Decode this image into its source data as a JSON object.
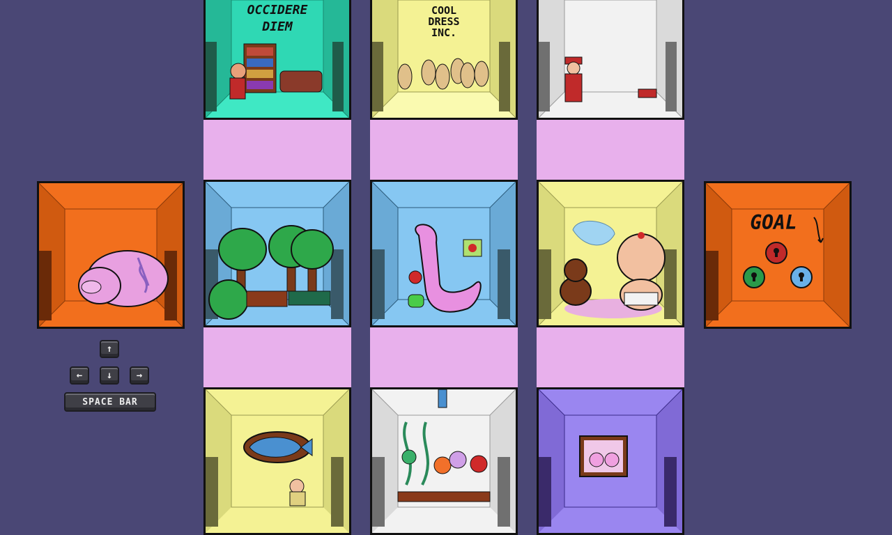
{
  "rooms": {
    "occidere": {
      "sign_line1": "OCCIDERE",
      "sign_line2": "DIEM"
    },
    "cool_dress": {
      "sign_line1": "COOL",
      "sign_line2": "DRESS",
      "sign_line3": "INC."
    },
    "goal": {
      "sign": "GOAL"
    }
  },
  "controls": {
    "up_key": "↑",
    "left_key": "←",
    "down_key": "↓",
    "right_key": "→",
    "space_bar": "SPACE BAR"
  },
  "colors": {
    "background": "#4a4775",
    "corridor": "#e8b0ec",
    "orange_room": "#f26f1d",
    "teal_room": "#2fd8b4",
    "yellow_room": "#f4f294",
    "blue_room": "#86c7f2",
    "purple_room": "#9a86f0",
    "white_room": "#f2f2f2"
  }
}
